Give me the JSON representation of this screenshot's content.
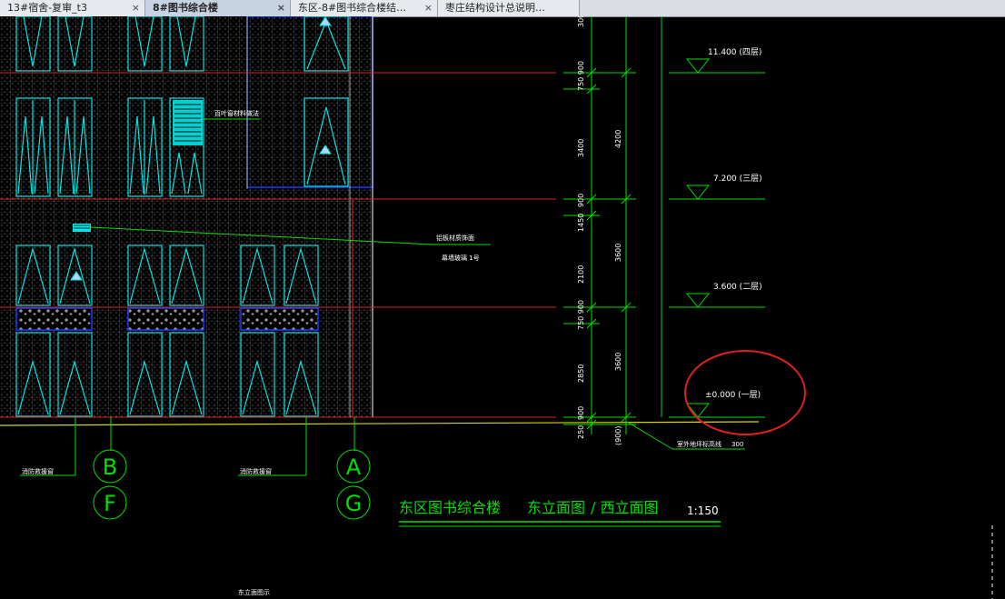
{
  "tabs": [
    {
      "label": "13#宿舍-复审_t3",
      "close": "×"
    },
    {
      "label": "8#图书综合楼",
      "close": "×"
    },
    {
      "label": "东区-8#图书综合楼结…",
      "close": "×"
    },
    {
      "label": "枣庄结构设计总说明…",
      "close": ""
    }
  ],
  "drawing": {
    "elevation_labels": [
      "11.400 (四层)",
      "7.200 (三层)",
      "3.600 (二层)",
      "±0.000 (一层)"
    ],
    "vertical_dims_left": [
      "300",
      "750 900",
      "3400",
      "900",
      "1450",
      "2100",
      "750 900",
      "2850",
      "250",
      "900"
    ],
    "vertical_dims_right": [
      "4200",
      "3600",
      "3600",
      "(900)"
    ],
    "axis_labels": [
      "B",
      "F",
      "A",
      "G"
    ],
    "annotations": {
      "window_note": "百叶窗材料做法",
      "wall_note_1": "铝板材质饰面",
      "wall_note_2": "幕墙玻璃  1号",
      "ground_note": "室外地坪标高线",
      "ground_dim": "300",
      "left_note_1": "消防救援窗",
      "left_note_2": "消防救援窗",
      "bottom_note": "东立面图示"
    },
    "title_block": {
      "building": "东区图书综合楼",
      "view": "东立面图",
      "view2": "/ 西立面图",
      "scale": "1:150"
    }
  },
  "colors": {
    "background": "#000000",
    "grid": "#808080",
    "red_line": "#e02020",
    "cyan": "#00e5e5",
    "green": "#00e000",
    "white": "#ffffff",
    "blue": "#1a3cff",
    "yellow": "#d8d800",
    "highlight_circle": "#e02020"
  }
}
